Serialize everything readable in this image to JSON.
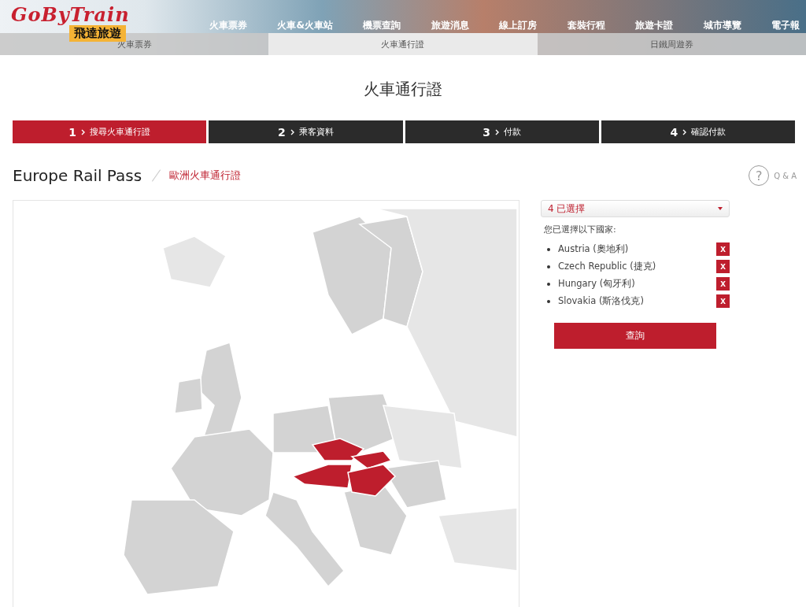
{
  "logo": {
    "wordmark": "GoByTrain",
    "name": "飛達旅遊"
  },
  "nav": [
    "火車票券",
    "火車&火車站",
    "機票查詢",
    "旅遊消息",
    "線上訂房",
    "套裝行程",
    "旅遊卡證",
    "城市導覽",
    "電子報"
  ],
  "subtabs": [
    {
      "label": "火車票券",
      "selected": false
    },
    {
      "label": "火車通行證",
      "selected": true
    },
    {
      "label": "日鐵周遊券",
      "selected": false
    }
  ],
  "page_title": "火車通行證",
  "steps": [
    {
      "number": "1",
      "label": "搜尋火車通行證",
      "selected": true
    },
    {
      "number": "2",
      "label": "乘客資料",
      "selected": false
    },
    {
      "number": "3",
      "label": "付款",
      "selected": false
    },
    {
      "number": "4",
      "label": "確認付款",
      "selected": false
    }
  ],
  "heading": {
    "title": "Europe Rail Pass",
    "subtitle": "歐洲火車通行證",
    "help": "?",
    "help_label": "Q & A"
  },
  "selector": {
    "value": "4 已選擇",
    "intro": "您已選擇以下國家:",
    "countries": [
      {
        "name": "Austria (奧地利)",
        "remove": "x"
      },
      {
        "name": "Czech Republic (捷克)",
        "remove": "x"
      },
      {
        "name": "Hungary (匈牙利)",
        "remove": "x"
      },
      {
        "name": "Slovakia (斯洛伐克)",
        "remove": "x"
      }
    ],
    "search_button": "查詢"
  }
}
